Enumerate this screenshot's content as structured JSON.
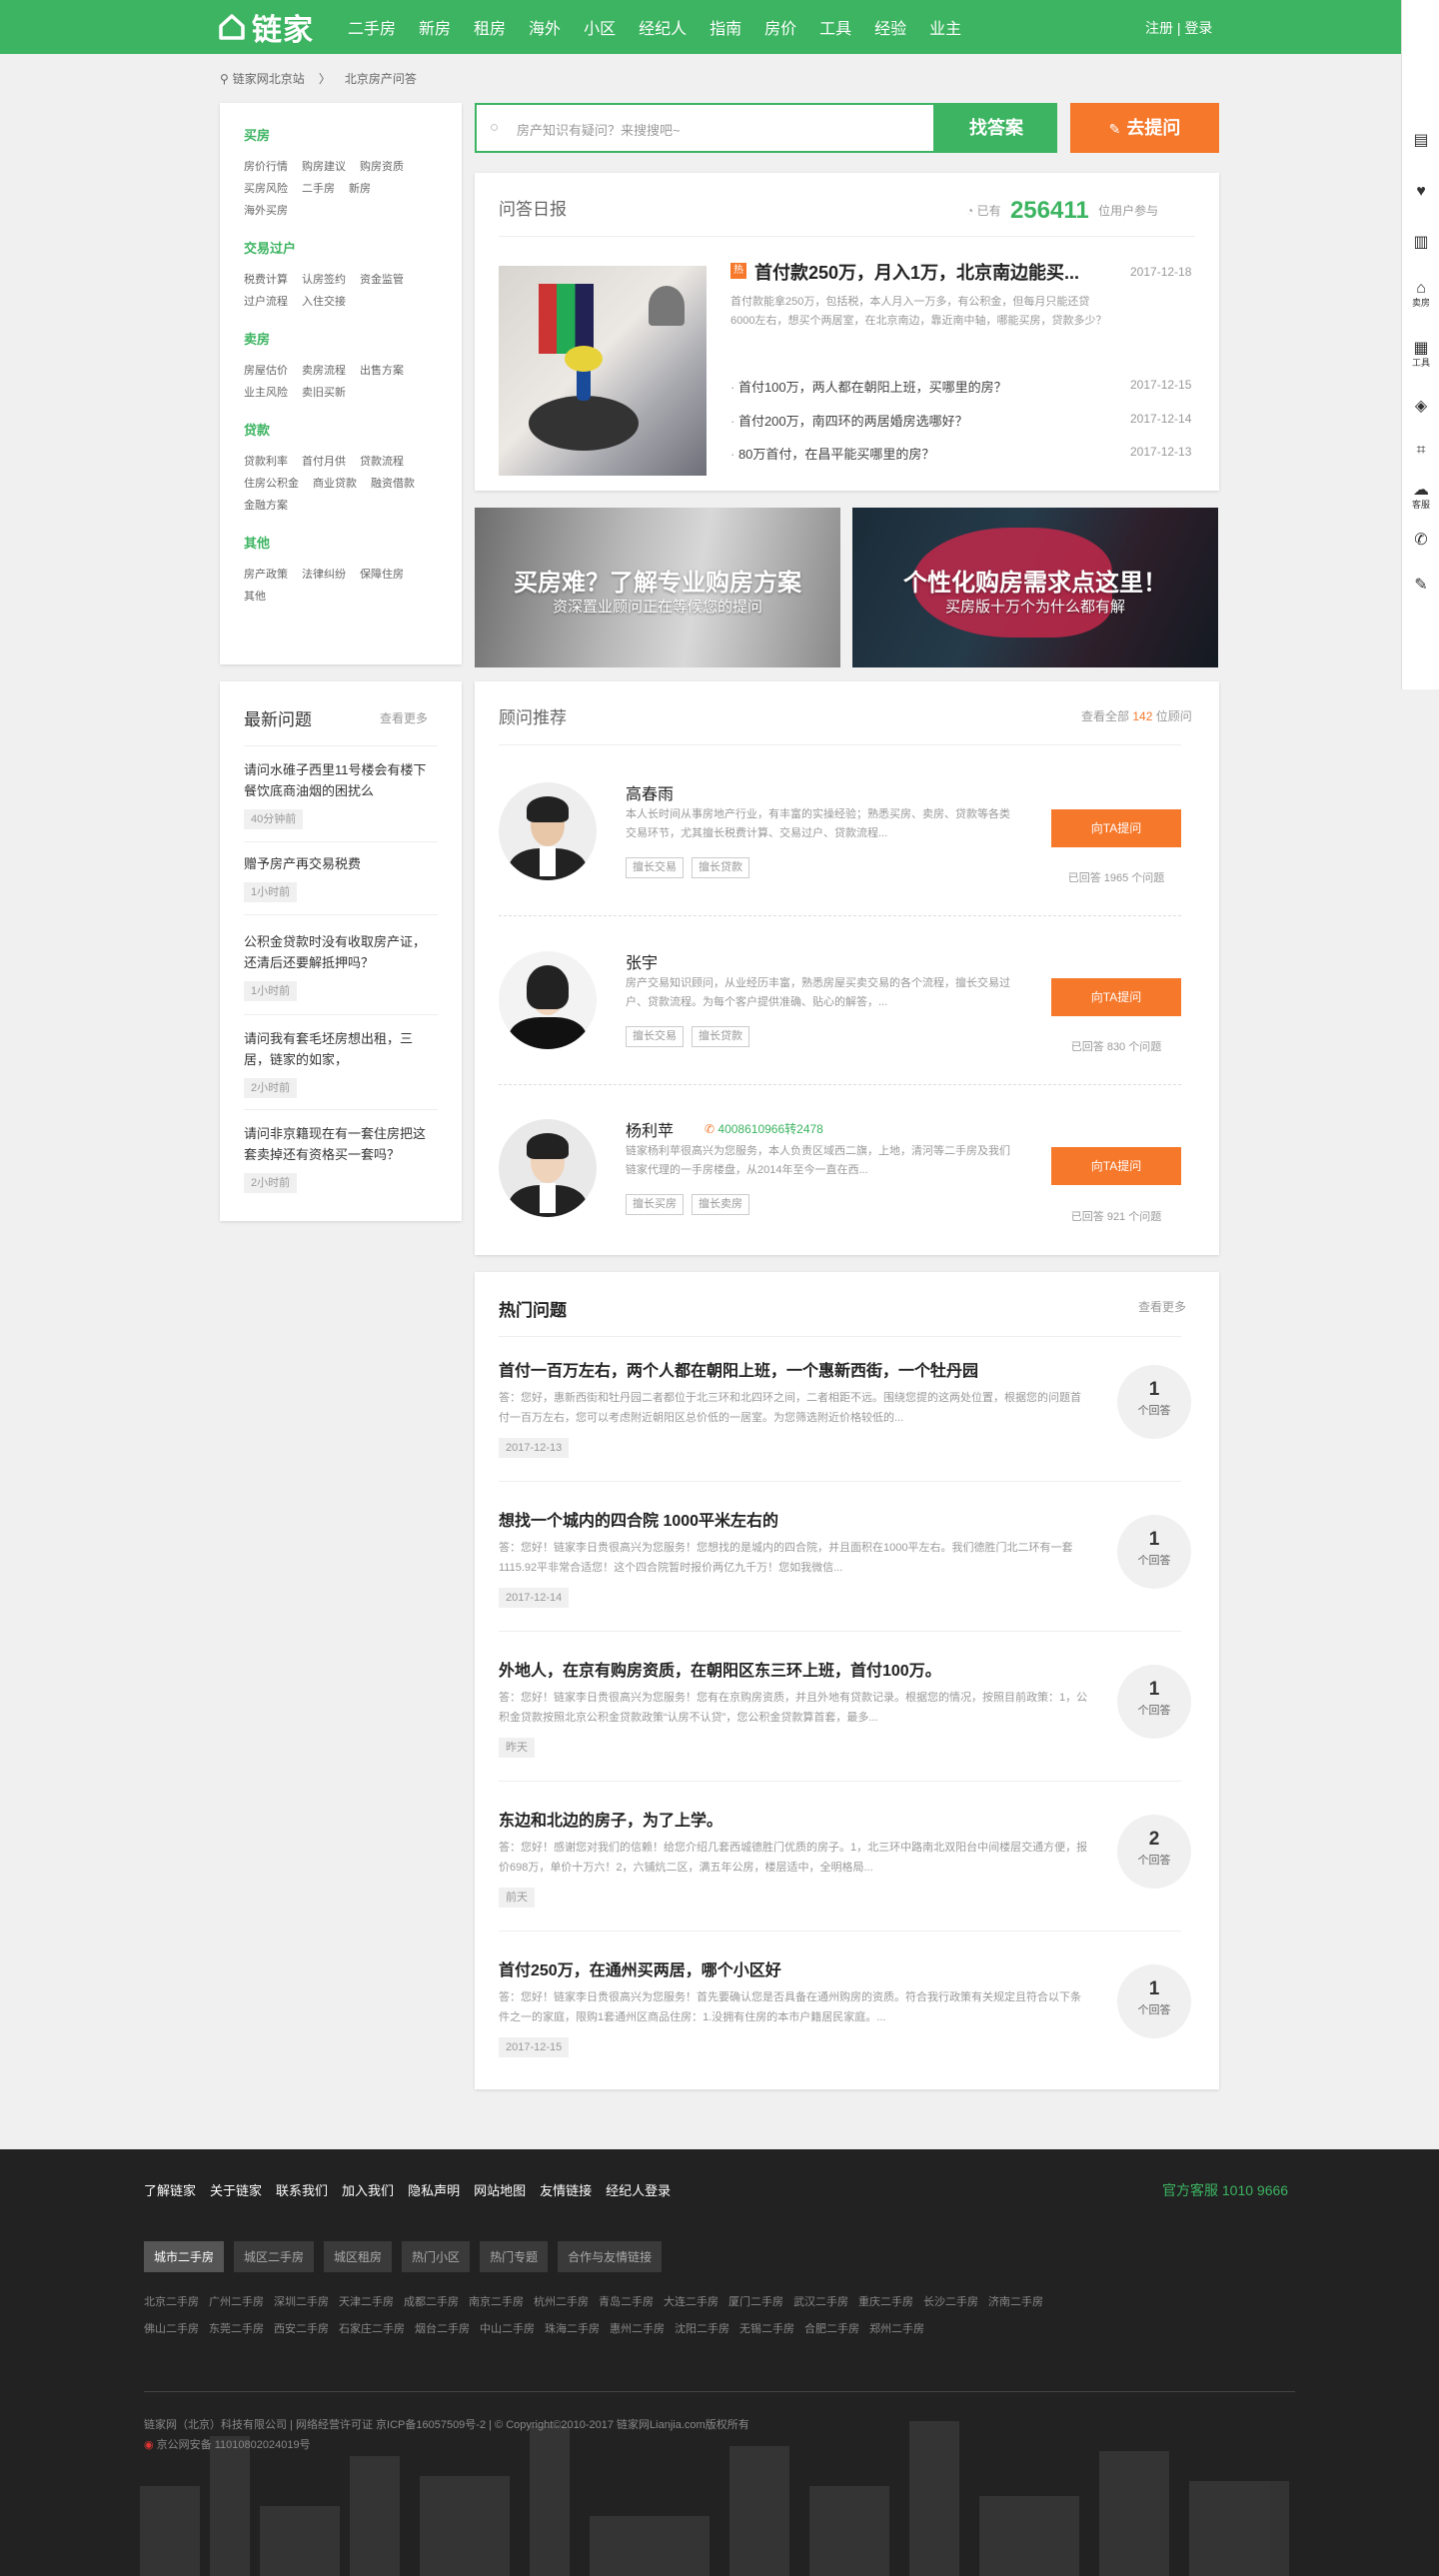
{
  "header": {
    "logo_text": "链家",
    "nav": [
      "二手房",
      "新房",
      "租房",
      "海外",
      "小区",
      "经纪人",
      "指南",
      "房价",
      "工具",
      "经验",
      "业主"
    ],
    "auth": "注册 | 登录"
  },
  "rightbar": {
    "items": [
      {
        "icon": "clipboard-icon",
        "label": ""
      },
      {
        "icon": "heart-icon",
        "label": ""
      },
      {
        "icon": "building-icon",
        "label": ""
      },
      {
        "icon": "house-icon",
        "label": "卖房"
      },
      {
        "icon": "grid-icon",
        "label": "工具"
      },
      {
        "icon": "shield-icon",
        "label": ""
      },
      {
        "icon": "scan-icon",
        "label": ""
      },
      {
        "icon": "chat-icon",
        "label": "客服"
      },
      {
        "icon": "phone-icon",
        "label": ""
      },
      {
        "icon": "edit-icon",
        "label": ""
      }
    ]
  },
  "breadcrumb": {
    "site": "链家网北京站",
    "sep": "〉",
    "page": "北京房产问答"
  },
  "categories": [
    {
      "title": "买房",
      "links": [
        "房价行情",
        "购房建议",
        "购房资质",
        "买房风险",
        "二手房",
        "新房",
        "海外买房"
      ]
    },
    {
      "title": "交易过户",
      "links": [
        "税费计算",
        "认房签约",
        "资金监管",
        "过户流程",
        "入住交接"
      ]
    },
    {
      "title": "卖房",
      "links": [
        "房屋估价",
        "卖房流程",
        "出售方案",
        "业主风险",
        "卖旧买新"
      ]
    },
    {
      "title": "贷款",
      "links": [
        "贷款利率",
        "首付月供",
        "贷款流程",
        "住房公积金",
        "商业贷款",
        "融资借款",
        "金融方案"
      ]
    },
    {
      "title": "其他",
      "links": [
        "房产政策",
        "法律纠纷",
        "保障住房",
        "其他"
      ]
    }
  ],
  "search": {
    "placeholder": "房产知识有疑问？来搜搜吧~",
    "find_label": "找答案",
    "ask_label": "去提问"
  },
  "daily": {
    "title": "问答日报",
    "count_prefix": "已有",
    "count": "256411",
    "count_suffix": "位用户参与",
    "tag": "热",
    "headline": "首付款250万，月入1万，北京南边能买...",
    "headline_date": "2017-12-18",
    "summary": "首付款能拿250万，包括税，本人月入一万多，有公积金，但每月只能还贷6000左右，想买个两居室，在北京南边，靠近南中轴，哪能买房，贷款多少？",
    "questions": [
      {
        "text": "首付100万，两人都在朝阳上班，买哪里的房？",
        "date": "2017-12-15"
      },
      {
        "text": "首付200万，南四环的两居婚房选哪好？",
        "date": "2017-12-14"
      },
      {
        "text": "80万首付，在昌平能买哪里的房？",
        "date": "2017-12-13"
      }
    ]
  },
  "banners": [
    {
      "title": "买房难？了解专业购房方案",
      "subtitle": "资深置业顾问正在等候您的提问"
    },
    {
      "title": "个性化购房需求点这里！",
      "subtitle": "买房版十万个为什么都有解"
    }
  ],
  "latest": {
    "title": "最新问题",
    "more": "查看更多",
    "items": [
      {
        "text": "请问水碓子西里11号楼会有楼下餐饮底商油烟的困扰么",
        "time": "40分钟前"
      },
      {
        "text": "赠予房产再交易税费",
        "time": "1小时前"
      },
      {
        "text": "公积金贷款时没有收取房产证，还清后还要解抵押吗？",
        "time": "1小时前"
      },
      {
        "text": "请问我有套毛坯房想出租，三居，链家的如家，",
        "time": "2小时前"
      },
      {
        "text": "请问非京籍现在有一套住房把这套卖掉还有资格买一套吗？",
        "time": "2小时前"
      }
    ]
  },
  "advisors": {
    "title": "顾问推荐",
    "more_prefix": "查看全部",
    "more_count": "142",
    "more_suffix": "位顾问",
    "items": [
      {
        "name": "高春雨",
        "phone": "",
        "desc": "本人长时间从事房地产行业，有丰富的实操经验；熟悉买房、卖房、贷款等各类交易环节，尤其擅长税费计算、交易过户、贷款流程...",
        "tags": [
          "擅长交易",
          "擅长贷款"
        ],
        "button": "向TA提问",
        "answered": "已回答 1965 个问题"
      },
      {
        "name": "张宇",
        "phone": "",
        "desc": "房产交易知识顾问，从业经历丰富，熟悉房屋买卖交易的各个流程，擅长交易过户、贷款流程。为每个客户提供准确、贴心的解答，...",
        "tags": [
          "擅长交易",
          "擅长贷款"
        ],
        "button": "向TA提问",
        "answered": "已回答 830 个问题"
      },
      {
        "name": "杨利苹",
        "phone": "4008610966转2478",
        "desc": "链家杨利苹很高兴为您服务，本人负责区域西二旗，上地，清河等二手房及我们链家代理的一手房楼盘，从2014年至今一直在西...",
        "tags": [
          "擅长买房",
          "擅长卖房"
        ],
        "button": "向TA提问",
        "answered": "已回答 921 个问题"
      }
    ]
  },
  "hot": {
    "title": "热门问题",
    "more": "查看更多",
    "items": [
      {
        "q": "首付一百万左右，两个人都在朝阳上班，一个惠新西街，一个牡丹园",
        "a": "答：您好，惠新西街和牡丹园二者都位于北三环和北四环之间，二者相距不远。围绕您提的这两处位置，根据您的问题首付一百万左右，您可以考虑附近朝阳区总价低的一居室。为您筛选附近价格较低的...",
        "date": "2017-12-13",
        "count": "1",
        "unit": "个回答"
      },
      {
        "q": "想找一个城内的四合院 1000平米左右的",
        "a": "答：您好！链家李日贵很高兴为您服务！您想找的是城内的四合院，并且面积在1000平左右。我们德胜门北二环有一套1115.92平非常合适您！这个四合院暂时报价两亿九千万！您如我微信...",
        "date": "2017-12-14",
        "count": "1",
        "unit": "个回答"
      },
      {
        "q": "外地人，在京有购房资质，在朝阳区东三环上班，首付100万。",
        "a": "答：您好！链家李日贵很高兴为您服务！您有在京购房资质，并且外地有贷款记录。根据您的情况，按照目前政策：1，公积金贷款按照北京公积金贷款政策“认房不认贷”，您公积金贷款算首套，最多...",
        "date": "昨天",
        "count": "1",
        "unit": "个回答"
      },
      {
        "q": "东边和北边的房子，为了上学。",
        "a": "答：您好！感谢您对我们的信赖！给您介绍几套西城德胜门优质的房子。1，北三环中路南北双阳台中间楼层交通方便，报价698万，单价十万六！2，六铺炕二区，满五年公房，楼层适中，全明格局...",
        "date": "前天",
        "count": "2",
        "unit": "个回答"
      },
      {
        "q": "首付250万，在通州买两居，哪个小区好",
        "a": "答：您好！链家李日贵很高兴为您服务！首先要确认您是否具备在通州购房的资质。符合我行政策有关规定且符合以下条件之一的家庭，限购1套通州区商品住房：1.没拥有住房的本市户籍居民家庭。...",
        "date": "2017-12-15",
        "count": "1",
        "unit": "个回答"
      }
    ]
  },
  "footer": {
    "links": [
      "了解链家",
      "关于链家",
      "联系我们",
      "加入我们",
      "隐私声明",
      "网站地图",
      "友情链接",
      "经纪人登录"
    ],
    "hotline": "官方客服 1010 9666",
    "tabs": [
      "城市二手房",
      "城区二手房",
      "城区租房",
      "热门小区",
      "热门专题",
      "合作与友情链接"
    ],
    "cities1": [
      "北京二手房",
      "广州二手房",
      "深圳二手房",
      "天津二手房",
      "成都二手房",
      "南京二手房",
      "杭州二手房",
      "青岛二手房",
      "大连二手房",
      "厦门二手房",
      "武汉二手房",
      "重庆二手房",
      "长沙二手房",
      "济南二手房"
    ],
    "cities2": [
      "佛山二手房",
      "东莞二手房",
      "西安二手房",
      "石家庄二手房",
      "烟台二手房",
      "中山二手房",
      "珠海二手房",
      "惠州二手房",
      "沈阳二手房",
      "无锡二手房",
      "合肥二手房",
      "郑州二手房"
    ],
    "copyright": "链家网（北京）科技有限公司 | 网络经营许可证 京ICP备16057509号-2 | © Copyright©2010-2017 链家网Lianjia.com版权所有",
    "police": "京公网安备 11010802024019号"
  }
}
